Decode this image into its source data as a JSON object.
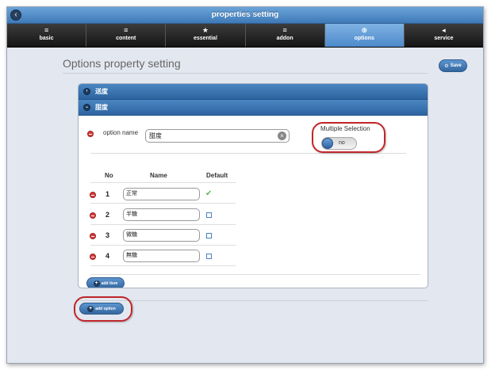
{
  "window": {
    "title": "properties setting"
  },
  "tabs": [
    {
      "label": "basic",
      "icon": "list-icon",
      "glyph": "≡"
    },
    {
      "label": "content",
      "icon": "list-icon",
      "glyph": "≡"
    },
    {
      "label": "essential",
      "icon": "star-icon",
      "glyph": "★"
    },
    {
      "label": "addon",
      "icon": "list-icon",
      "glyph": "≡"
    },
    {
      "label": "options",
      "icon": "plus-circle-icon",
      "glyph": "⊕",
      "active": true
    },
    {
      "label": "service",
      "icon": "chevron-left-icon",
      "glyph": "◂"
    }
  ],
  "page": {
    "title": "Options property setting",
    "save_label": "Save"
  },
  "accordion": [
    {
      "label": "送度",
      "state": "collapsed"
    },
    {
      "label": "甜度",
      "state": "expanded"
    }
  ],
  "option": {
    "name_label": "option name",
    "name_value": "甜度",
    "multiple_selection_label": "Multiple Selection",
    "multiple_selection_value": "no"
  },
  "table": {
    "headers": {
      "no": "No",
      "name": "Name",
      "default": "Default"
    },
    "rows": [
      {
        "no": "1",
        "name": "正常",
        "default": true
      },
      {
        "no": "2",
        "name": "半糖",
        "default": false
      },
      {
        "no": "3",
        "name": "微糖",
        "default": false
      },
      {
        "no": "4",
        "name": "無糖",
        "default": false
      }
    ]
  },
  "buttons": {
    "add_item": "add item",
    "add_option": "add option"
  },
  "colors": {
    "accent": "#3f7ab8",
    "tab_active": "#6aa0d8",
    "highlight": "#c0262b",
    "delete": "#d23b3b",
    "check": "#5cb85c"
  }
}
